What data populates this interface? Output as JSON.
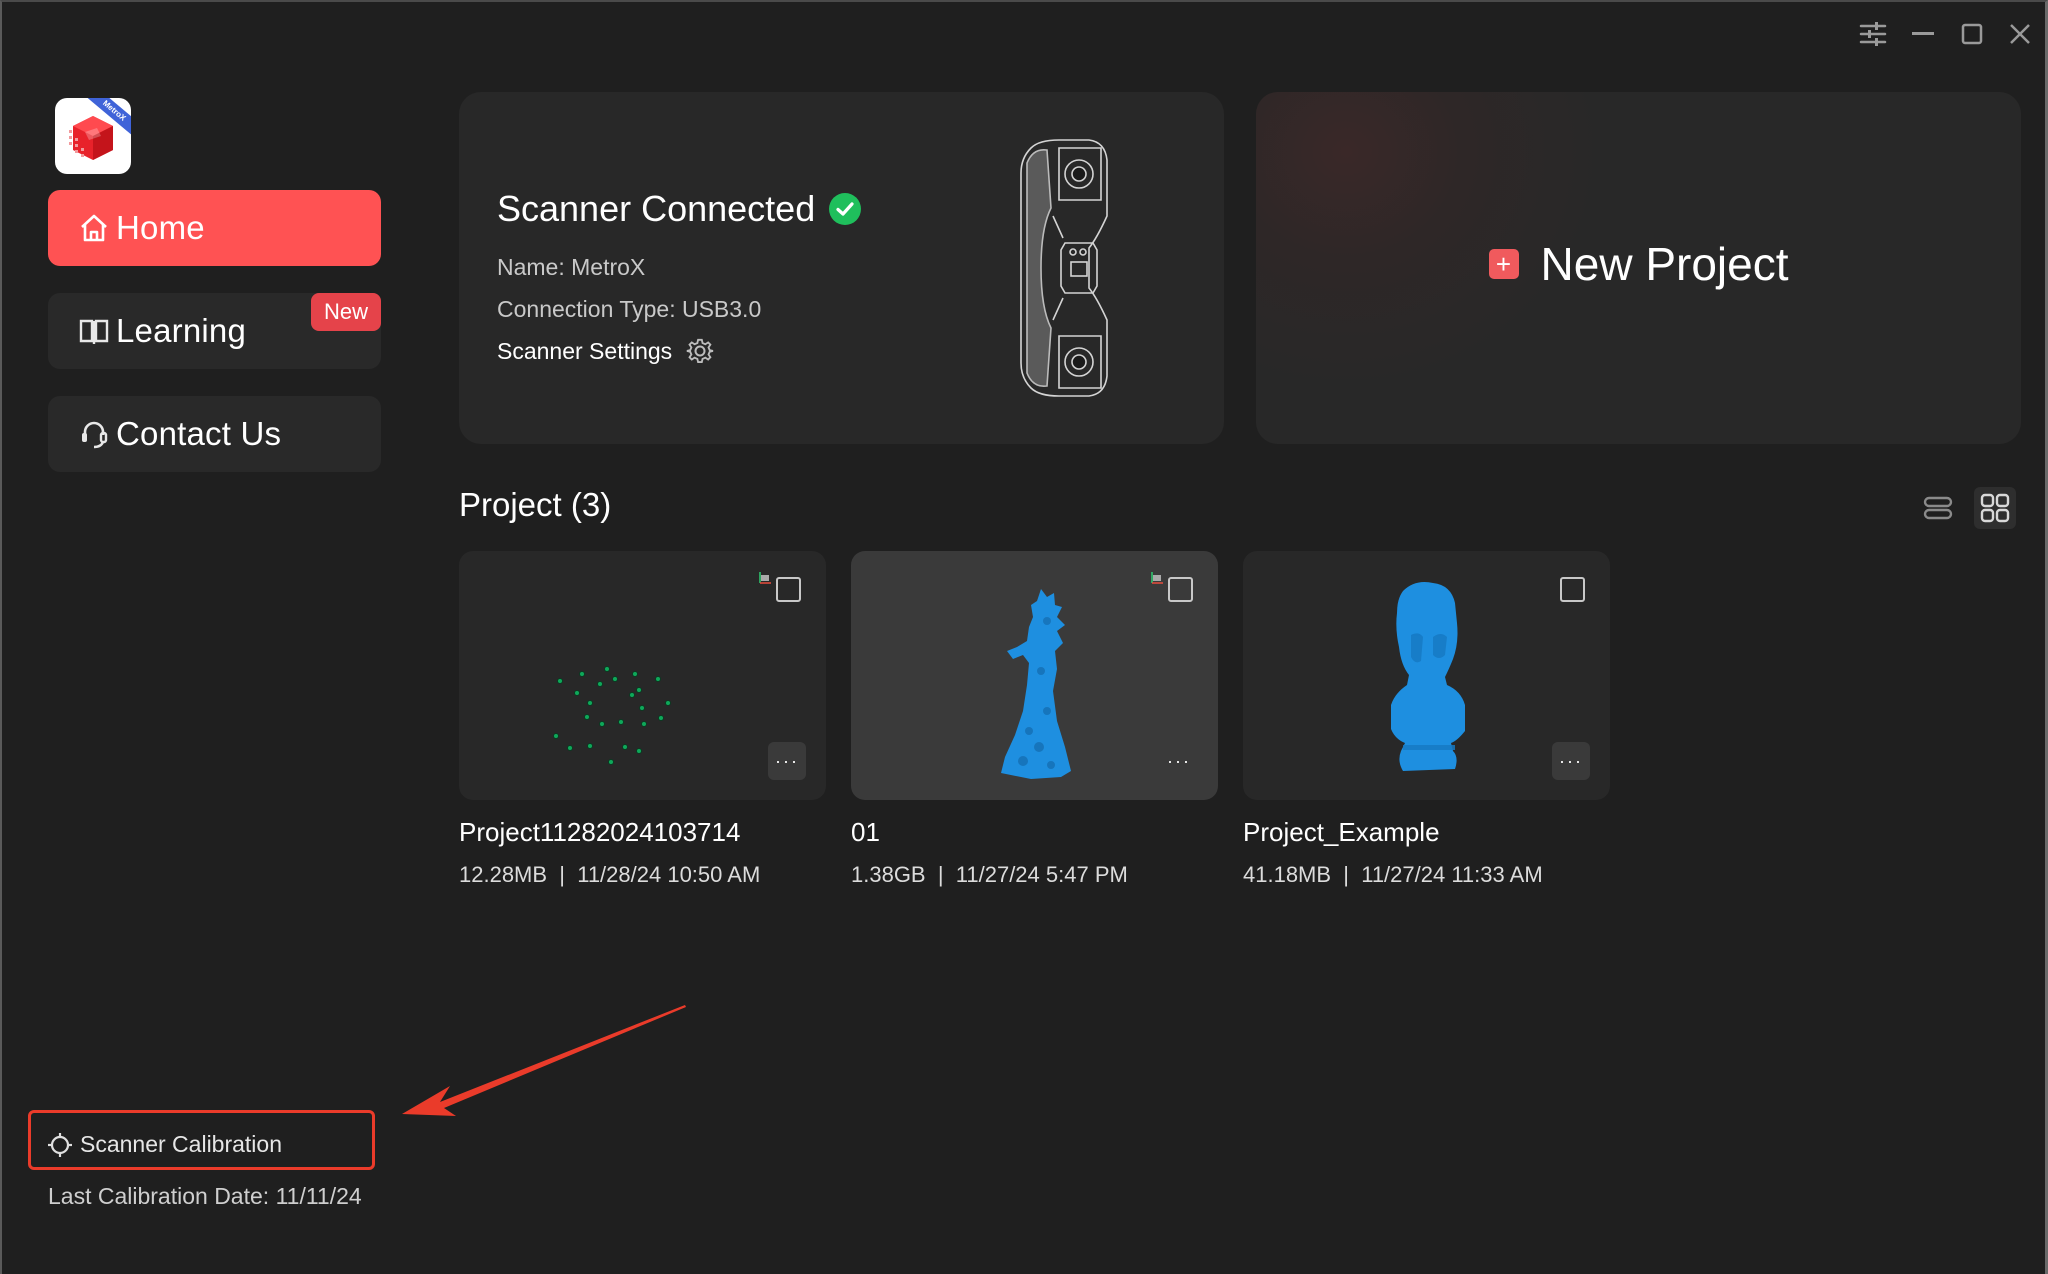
{
  "window": {
    "controls": [
      {
        "name": "settings-sliders-icon",
        "label": "settings"
      },
      {
        "name": "minimize-icon",
        "label": "minimize"
      },
      {
        "name": "maximize-icon",
        "label": "maximize"
      },
      {
        "name": "close-icon",
        "label": "close"
      }
    ]
  },
  "logo": {
    "ribbon_text": "MetroX"
  },
  "sidebar": {
    "items": [
      {
        "label": "Home",
        "icon": "home-icon",
        "active": true
      },
      {
        "label": "Learning",
        "icon": "book-icon",
        "badge": "New"
      },
      {
        "label": "Contact Us",
        "icon": "headset-icon"
      }
    ],
    "calibration": {
      "label": "Scanner Calibration",
      "icon": "crosshair-icon",
      "last_date_text": "Last Calibration Date: 11/11/24"
    }
  },
  "scanner": {
    "status_title": "Scanner Connected",
    "status_icon": "check-circle-icon",
    "name_line": "Name: MetroX",
    "connection_line": "Connection Type: USB3.0",
    "settings_label": "Scanner Settings",
    "settings_icon": "gear-icon"
  },
  "new_project": {
    "label": "New Project",
    "icon": "plus-square-icon"
  },
  "projects": {
    "heading": "Project (3)",
    "view_modes": [
      {
        "name": "list-view",
        "icon": "list-view-icon",
        "active": false
      },
      {
        "name": "grid-view",
        "icon": "grid-view-icon",
        "active": true
      }
    ],
    "items": [
      {
        "name": "Project11282024103714",
        "size": "12.28MB",
        "date": "11/28/24 10:50 AM",
        "thumbnail": "green point markers",
        "meta": "12.28MB  |  11/28/24 10:50 AM"
      },
      {
        "name": "01",
        "size": "1.38GB",
        "date": "11/27/24 5:47 PM",
        "thumbnail": "blue figure statue scan",
        "meta": "1.38GB  |  11/27/24 5:47 PM"
      },
      {
        "name": "Project_Example",
        "size": "41.18MB",
        "date": "11/27/24 11:33 AM",
        "thumbnail": "blue bust scan",
        "meta": "41.18MB  |  11/27/24 11:33 AM"
      }
    ],
    "more_label": "···"
  },
  "colors": {
    "accent": "#ff5253",
    "badge": "#e5434a",
    "success": "#1fbf5c",
    "scan_blue": "#1e8fe0",
    "annotation": "#ea3b2a",
    "background": "#1f1f1f",
    "card": "#282828"
  }
}
